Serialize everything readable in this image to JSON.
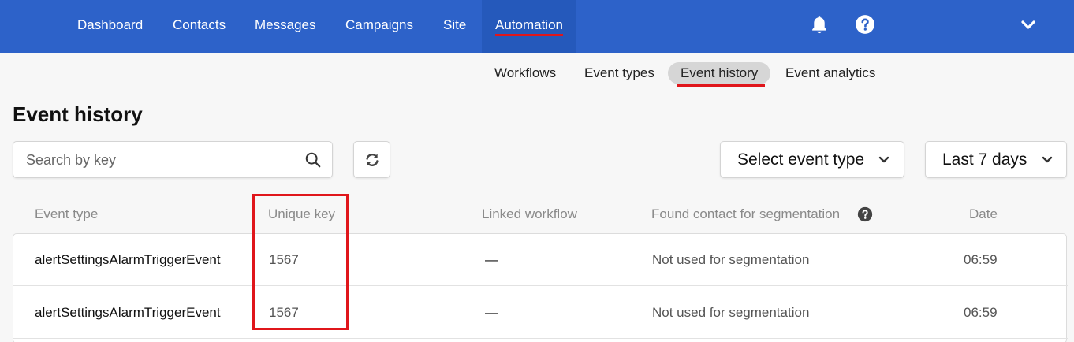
{
  "nav": {
    "items": [
      "Dashboard",
      "Contacts",
      "Messages",
      "Campaigns",
      "Site",
      "Automation"
    ],
    "active": "Automation",
    "accent_color": "#2d62c9",
    "underline_color": "#e0161b",
    "icons": [
      "bell-icon",
      "help-icon",
      "chevron-down-icon"
    ]
  },
  "subnav": {
    "items": [
      "Workflows",
      "Event types",
      "Event history",
      "Event analytics"
    ],
    "active": "Event history"
  },
  "page": {
    "title": "Event history"
  },
  "search": {
    "placeholder": "Search by key"
  },
  "filters": {
    "event_type": "Select event type",
    "period": "Last 7 days"
  },
  "table": {
    "headers": [
      "Event type",
      "Unique key",
      "Linked workflow",
      "Found contact for segmentation",
      "Date"
    ],
    "rows": [
      {
        "event_type": "alertSettingsAlarmTriggerEvent",
        "unique_key": "1567",
        "linked_workflow": "—",
        "found_contact": "Not used for segmentation",
        "date": "06:59"
      },
      {
        "event_type": "alertSettingsAlarmTriggerEvent",
        "unique_key": "1567",
        "linked_workflow": "—",
        "found_contact": "Not used for segmentation",
        "date": "06:59"
      }
    ]
  }
}
